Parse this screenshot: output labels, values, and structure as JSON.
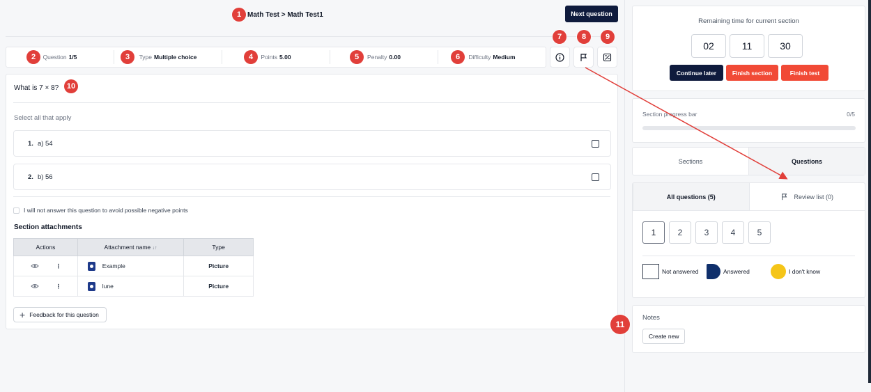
{
  "header": {
    "breadcrumb": "Math Test > Math Test1",
    "next_question_label": "Next question"
  },
  "info_bar": [
    {
      "key": "Question",
      "value": "1/5"
    },
    {
      "key": "Type",
      "value": "Multiple choice"
    },
    {
      "key": "Points",
      "value": "5.00"
    },
    {
      "key": "Penalty",
      "value": "0.00"
    },
    {
      "key": "Difficulty",
      "value": "Medium"
    }
  ],
  "toolbar_icons": [
    "info-icon",
    "flag-icon",
    "calculator-icon"
  ],
  "question": {
    "text": "What is 7 × 8?",
    "instruction": "Select all that apply",
    "options": [
      {
        "num": "1.",
        "label": "a) 54"
      },
      {
        "num": "2.",
        "label": "b) 56"
      }
    ],
    "no_answer_label": "I will not answer this question to avoid possible negative points"
  },
  "attachments": {
    "title": "Section attachments",
    "headers": {
      "actions": "Actions",
      "name": "Attachment name",
      "sort_glyph": "↓↑",
      "type": "Type"
    },
    "rows": [
      {
        "name": "Example",
        "type": "Picture"
      },
      {
        "name": "lune",
        "type": "Picture"
      }
    ]
  },
  "feedback_label": "Feedback for this question",
  "timer": {
    "title": "Remaining time for current section",
    "hours": "02",
    "minutes": "11",
    "seconds": "30",
    "continue_label": "Continue later",
    "finish_section_label": "Finish section",
    "finish_test_label": "Finish test"
  },
  "progress": {
    "label": "Section progress bar",
    "count": "0/5",
    "fraction": 0
  },
  "tabs": [
    "Sections",
    "Questions"
  ],
  "question_nav": {
    "all_label": "All questions (5)",
    "review_label": "Review list (0)",
    "numbers": [
      "1",
      "2",
      "3",
      "4",
      "5"
    ],
    "legend": {
      "not_answered": "Not answered",
      "answered": "Answered",
      "dont_know": "I don't know"
    }
  },
  "notes": {
    "title": "Notes",
    "create_label": "Create new"
  },
  "annotations": [
    "1",
    "2",
    "3",
    "4",
    "5",
    "6",
    "7",
    "8",
    "9",
    "10",
    "11"
  ],
  "colors": {
    "primary_dark": "#0f1b3d",
    "danger": "#f14a36",
    "badge": "#e13f3a",
    "answered": "#0f2f6b",
    "dont_know": "#f5c518"
  }
}
